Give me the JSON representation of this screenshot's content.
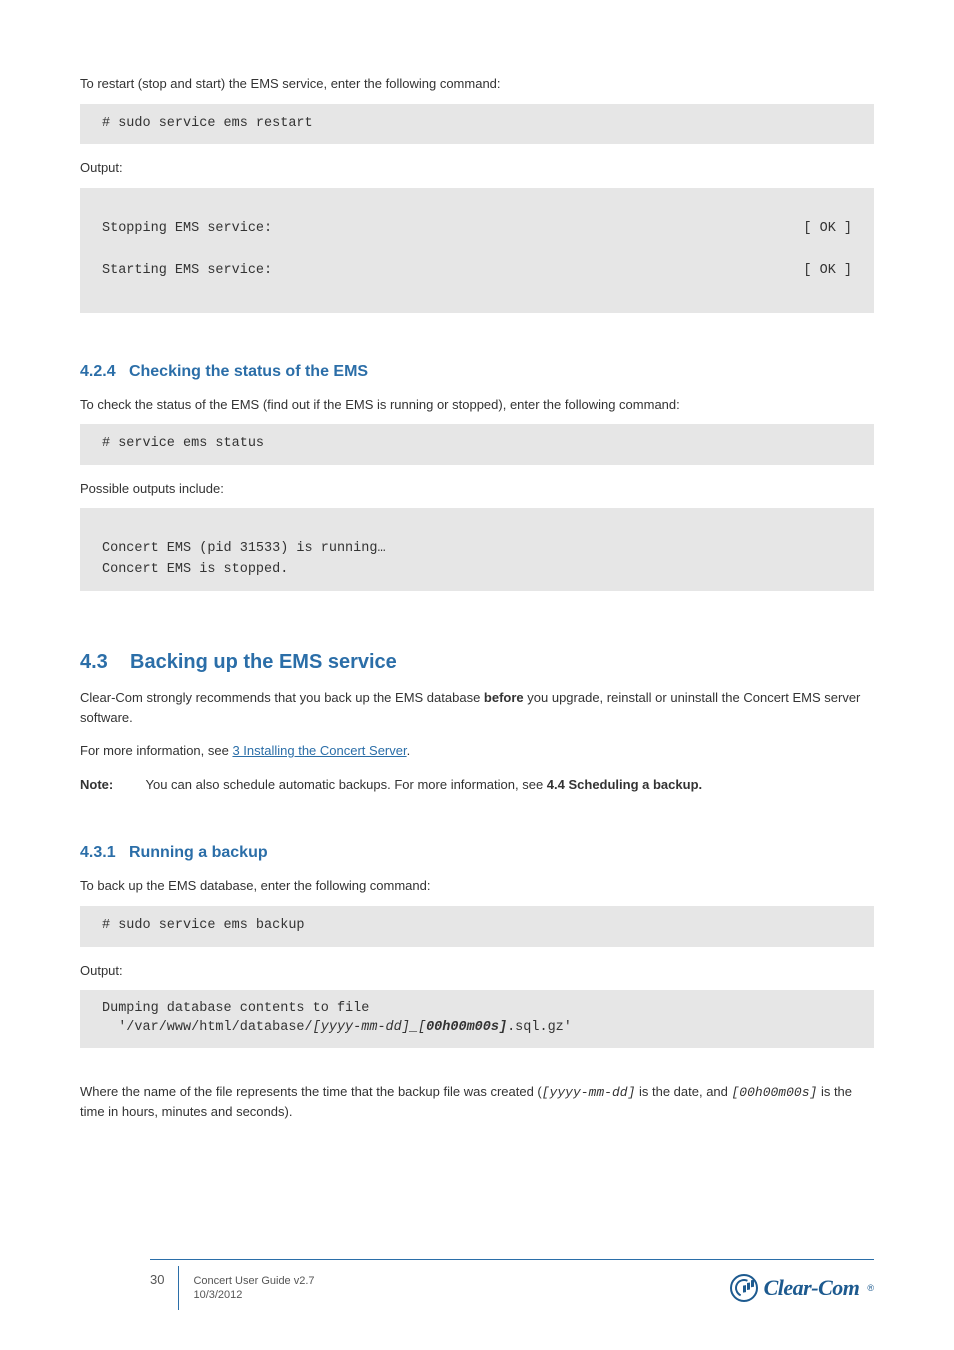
{
  "p_restart_intro": "To restart (stop and start) the EMS service, enter the following command:",
  "code_restart": "# sudo service ems restart",
  "p_output_label": "Output:",
  "code_restart_out_l1_left": "Stopping EMS service:",
  "code_restart_out_l1_right": "[ OK ]",
  "code_restart_out_l2_left": "Starting EMS service:",
  "code_restart_out_l2_right": "[ OK ]",
  "h3_status_num": "4.2.4",
  "h3_status_title": "Checking the status of the EMS",
  "p_status_intro": "To check the status of the EMS (find out if the EMS is running or stopped), enter the following command:",
  "code_status": "# service ems status",
  "p_possible": "Possible outputs include:",
  "code_status_out_l1": "Concert EMS (pid 31533) is running…",
  "code_status_out_l2": "Concert EMS is stopped.",
  "h2_num": "4.3",
  "h2_title": "Backing up the EMS service",
  "p_backup_intro_1": "Clear-Com strongly recommends that you back up the EMS database ",
  "p_backup_intro_bold": "before",
  "p_backup_intro_2": " you upgrade, reinstall or uninstall the Concert EMS server software.",
  "p_backup_more_1": "For more information, see ",
  "p_backup_link": "3 Installing the Concert Server",
  "p_backup_more_2": ".",
  "note_label": "Note:",
  "note_text": "You can also schedule automatic backups. For more information, see ",
  "note_bold": "4.4 Scheduling a backup.",
  "h3_backup_num": "4.3.1",
  "h3_backup_title": "Running a backup",
  "p_run_backup_intro": "To back up the EMS database, enter the following command:",
  "code_backup": "# sudo service ems backup",
  "code_backup_out_l1": "Dumping database contents to file",
  "code_backup_out_l2_a": "  '/var/www/html/database/",
  "code_backup_out_l2_b": "[yyyy-mm-dd]_[",
  "code_backup_out_l2_c": "00h00m00s]",
  "code_backup_out_l2_d": ".sql.gz'",
  "p_where_1": "Where the name of the file represents the time that the backup file was created (",
  "p_where_date": "[yyyy-mm-dd]",
  "p_where_2": " is the date, and ",
  "p_where_time": "[00h00m00s]",
  "p_where_3": " is the time in hours, minutes and seconds).",
  "footer_page": "30",
  "footer_l1": "Concert User Guide v2.7",
  "footer_l2": "10/3/2012",
  "logo_text": "Clear-Com"
}
